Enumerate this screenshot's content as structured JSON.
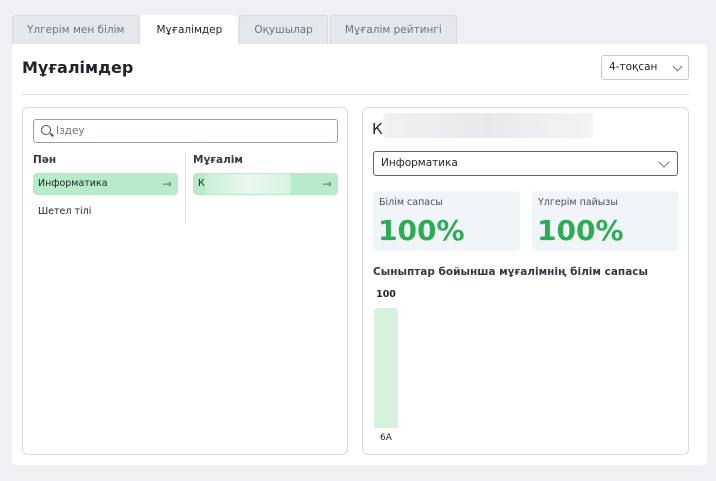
{
  "tabs": [
    {
      "label": "Үлгерім мен білім",
      "active": false
    },
    {
      "label": "Мұғалімдер",
      "active": true
    },
    {
      "label": "Оқушылар",
      "active": false
    },
    {
      "label": "Мұғалім рейтингі",
      "active": false
    }
  ],
  "page": {
    "title": "Мұғалімдер",
    "quarter_selected": "4-тоқсан"
  },
  "left": {
    "search_placeholder": "Іздеу",
    "subject_header": "Пән",
    "teacher_header": "Мұғалім",
    "subjects": [
      {
        "label": "Информатика",
        "selected": true
      },
      {
        "label": "Шетел тілі",
        "selected": false
      }
    ],
    "teachers": [
      {
        "label": "К",
        "selected": true
      }
    ]
  },
  "right": {
    "teacher_name": "К",
    "subject_selected": "Информатика",
    "stats": [
      {
        "label": "Білім сапасы",
        "value": "100%"
      },
      {
        "label": "Үлгерім пайызы",
        "value": "100%"
      }
    ]
  },
  "chart_data": {
    "type": "bar",
    "title": "Сыныптар бойынша мұғалімнің білім сапасы",
    "categories": [
      "6А"
    ],
    "values": [
      100
    ],
    "ylim": [
      0,
      100
    ],
    "bar_color": "#d6f2df"
  },
  "colors": {
    "accent_green": "#2dac55",
    "pill_green": "#b6ecc7"
  }
}
